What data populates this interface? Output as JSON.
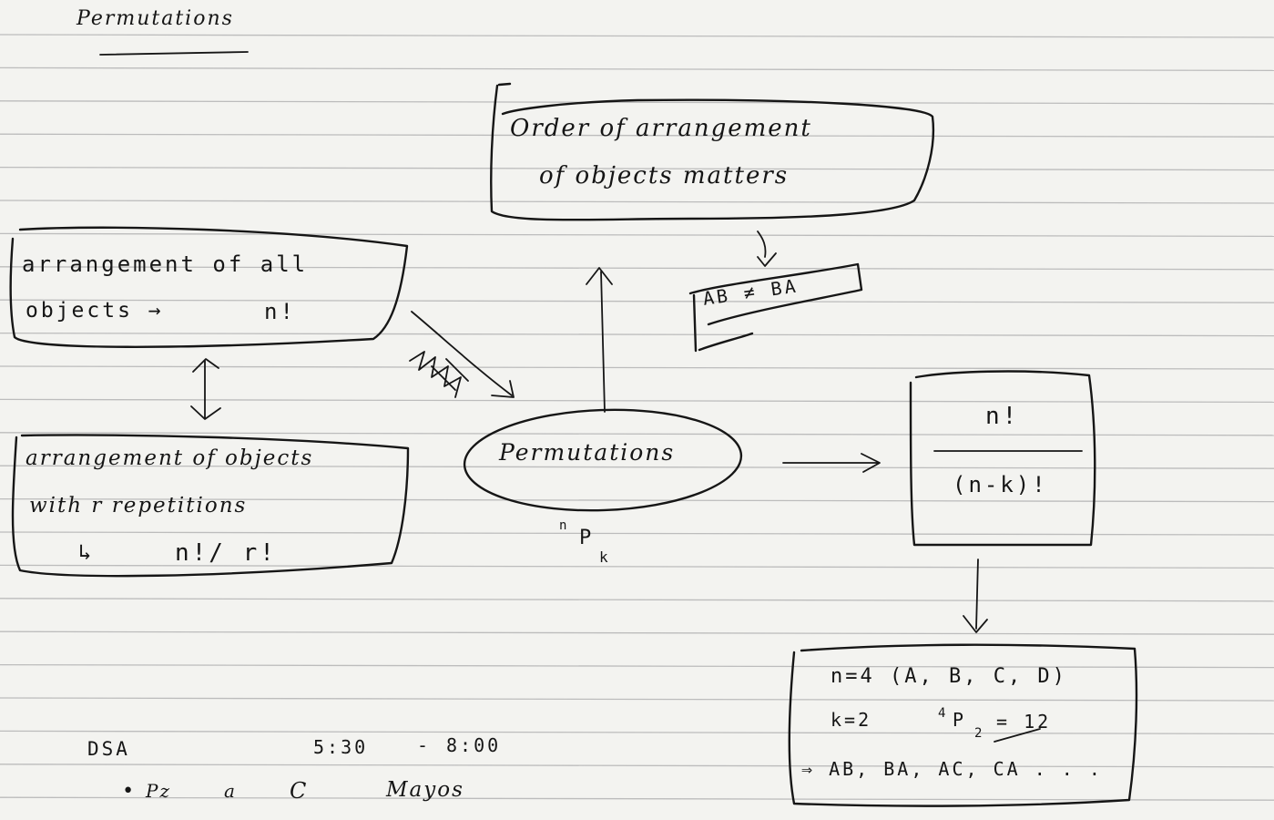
{
  "title": "Permutations",
  "definition": {
    "line1": "Order of arrangement",
    "line2": "of objects matters"
  },
  "example_inequality": "AB ≠ BA",
  "all_objects": {
    "line1": "arrangement of all",
    "line2": "objects →",
    "formula": "n!"
  },
  "repetition": {
    "line1": "arrangement of objects",
    "line2": "with r repetitions",
    "arrow": "↳",
    "formula": "n!/ r!"
  },
  "center": {
    "label": "Permutations",
    "notation_pre": "n",
    "notation_main": "P",
    "notation_sub": "k"
  },
  "formula_box": {
    "numerator": "n!",
    "denominator": "(n-k)!"
  },
  "example_box": {
    "line1": "n=4 (A, B, C, D)",
    "line2_left": "k=2",
    "line2_pre": "4",
    "line2_main": "P",
    "line2_sub": "2",
    "line2_result": "= 12",
    "line3": "⇒ AB, BA, AC, CA . . ."
  },
  "notes": {
    "dsa": "DSA",
    "time_start": "5:30",
    "time_dash": "-",
    "time_end": "8:00",
    "bullet": "•",
    "items": [
      "Pz",
      "a",
      "C",
      "Mayos"
    ]
  }
}
